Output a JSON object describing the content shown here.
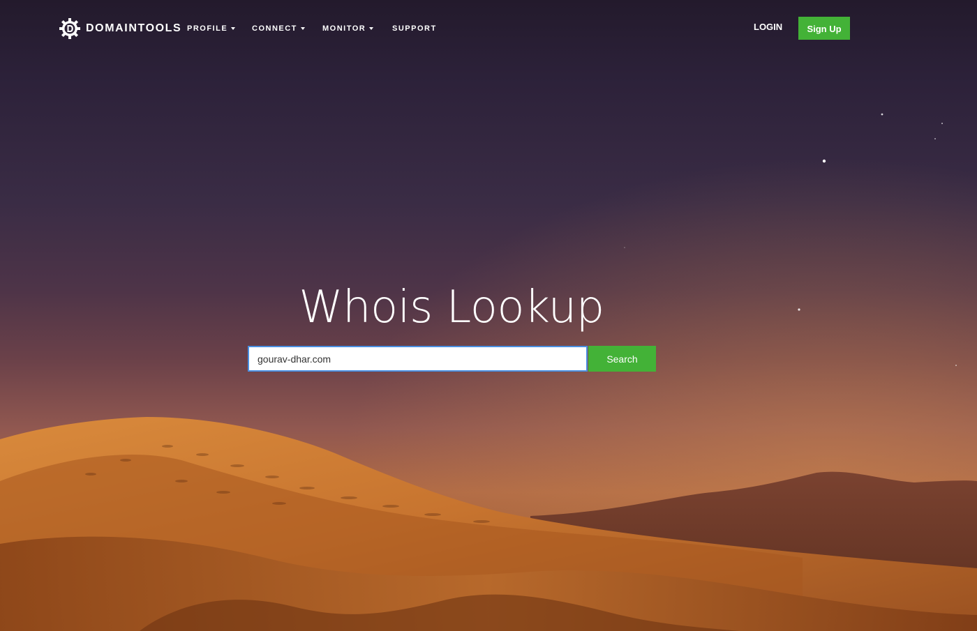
{
  "brand": {
    "logo_icon": "domaintools-gear-icon",
    "name": "DOMAINTOOLS"
  },
  "nav": {
    "items": [
      {
        "label": "PROFILE",
        "has_dropdown": true
      },
      {
        "label": "CONNECT",
        "has_dropdown": true
      },
      {
        "label": "MONITOR",
        "has_dropdown": true
      },
      {
        "label": "SUPPORT",
        "has_dropdown": false
      }
    ],
    "login_label": "LOGIN",
    "signup_label": "Sign Up"
  },
  "hero": {
    "title": "Whois Lookup",
    "search": {
      "value": "gourav-dhar.com",
      "placeholder": "",
      "button_label": "Search"
    }
  },
  "colors": {
    "accent_green": "#43b237",
    "input_focus_border": "#4a90e2",
    "text": "#ffffff"
  }
}
